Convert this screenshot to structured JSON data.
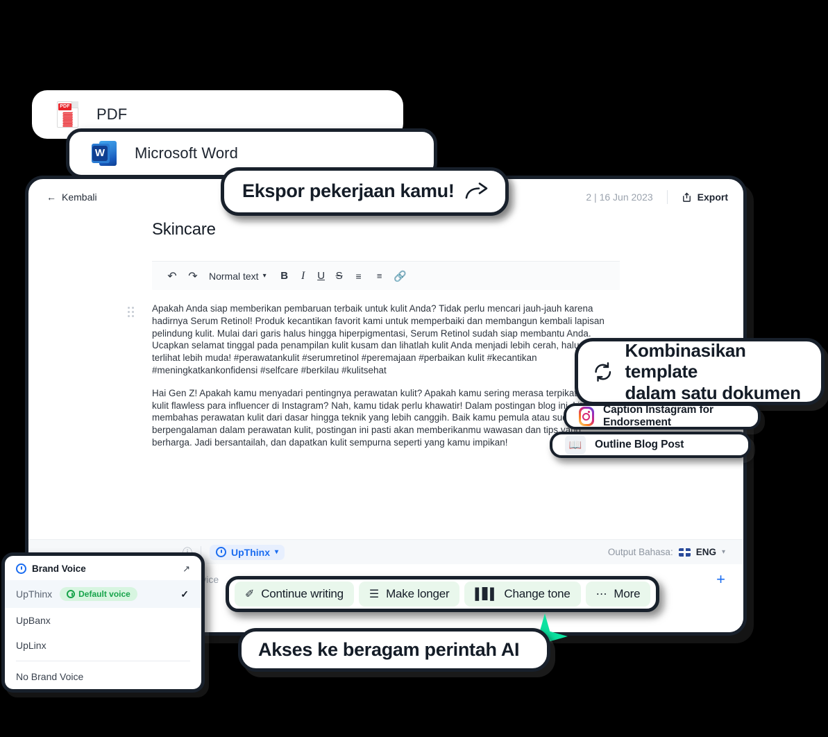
{
  "export_menu": {
    "pdf_label": "PDF",
    "pdf_icon": "pdf-file-icon",
    "pdf_badge": "PDF",
    "pdf_glyph": "A",
    "word_label": "Microsoft Word",
    "word_icon": "microsoft-word-icon",
    "word_glyph": "W"
  },
  "callouts": {
    "export": {
      "text": "Ekspor pekerjaan kamu!",
      "icon": "share-arrow-icon"
    },
    "template": {
      "text": "Kombinasikan template\ndalam satu dokumen",
      "icon": "refresh-cycle-icon"
    },
    "ai_commands": {
      "text": "Akses ke beragam perintah AI",
      "icon": "sparkle-star-icon"
    }
  },
  "app": {
    "header": {
      "back_label": "Kembali",
      "back_icon": "arrow-left-icon",
      "doc_meta": "2 | 16 Jun 2023",
      "export_label": "Export",
      "export_icon": "export-upload-icon"
    },
    "document": {
      "title": "Skincare",
      "paragraphs": [
        "Apakah Anda siap memberikan pembaruan terbaik untuk kulit Anda? Tidak perlu mencari jauh-jauh karena hadirnya Serum Retinol! Produk kecantikan favorit kami untuk memperbaiki dan membangun kembali lapisan pelindung kulit. Mulai dari garis halus hingga hiperpigmentasi, Serum Retinol sudah siap membantu Anda. Ucapkan selamat tinggal pada penampilan kulit kusam dan lihatlah kulit Anda menjadi lebih cerah, halus, dan terlihat lebih muda! #perawatankulit #serumretinol #peremajaan #perbaikan kulit #kecantikan #meningkatkankonfidensi #selfcare #berkilau #kulitsehat",
        "Hai Gen Z! Apakah kamu menyadari pentingnya perawatan kulit? Apakah kamu sering merasa terpikat dengan kulit flawless para influencer di Instagram? Nah, kamu tidak perlu khawatir! Dalam postingan blog ini, kita akan membahas perawatan kulit dari dasar hingga teknik yang lebih canggih. Baik kamu pemula atau sudah berpengalaman dalam perawatan kulit, postingan ini pasti akan memberikanmu wawasan dan tips yang berharga. Jadi bersantailah, dan dapatkan kulit sempurna seperti yang kamu impikan!"
      ]
    },
    "toolbar": {
      "undo_icon": "undo-arrow-icon",
      "redo_icon": "redo-arrow-icon",
      "style_label": "Normal text",
      "style_caret_icon": "chevron-down-icon",
      "bold_label": "B",
      "italic_label": "I",
      "underline_label": "U",
      "strike_label": "S",
      "bullet_icon": "bulleted-list-icon",
      "numbered_icon": "numbered-list-icon",
      "link_icon": "link-chain-icon"
    },
    "prompt": {
      "info_icon": "info-circle-icon",
      "model_label": "UpThinx",
      "model_icon": "brand-voice-icon",
      "model_caret_icon": "chevron-down-icon",
      "output_lang_label": "Output Bahasa:",
      "output_lang_value": "ENG",
      "output_lang_flag": "uk-flag-icon",
      "output_lang_caret_icon": "chevron-down-icon",
      "input_value": "s Advice",
      "add_icon": "plus-icon"
    }
  },
  "template_items": [
    {
      "label": "Caption Instagram for Endorsement",
      "icon": "instagram-icon"
    },
    {
      "label": "Outline Blog Post",
      "icon": "open-book-icon"
    }
  ],
  "ai_commands": [
    {
      "label": "Continue writing",
      "icon": "pen-nib-icon"
    },
    {
      "label": "Make longer",
      "icon": "lines-icon"
    },
    {
      "label": "Change tone",
      "icon": "waveform-icon"
    },
    {
      "label": "More",
      "icon": "ellipsis-icon"
    }
  ],
  "brand_voice": {
    "title": "Brand Voice",
    "title_icon": "brand-voice-icon",
    "external_icon": "external-link-icon",
    "items": [
      {
        "label": "UpThinx",
        "badge": "Default voice",
        "badge_icon": "brand-voice-icon",
        "selected": true,
        "check_icon": "check-icon"
      },
      {
        "label": "UpBanx",
        "badge": "",
        "selected": false
      },
      {
        "label": "UpLinx",
        "badge": "",
        "selected": false
      }
    ],
    "none_label": "No Brand Voice"
  },
  "colors": {
    "dark_border": "#18202b",
    "accent_blue": "#1a6cf0",
    "accent_green": "#0ce2a0",
    "chip_green_bg": "#e9f7ec",
    "badge_green_bg": "#d7f5e0",
    "badge_green_fg": "#16a34a"
  }
}
